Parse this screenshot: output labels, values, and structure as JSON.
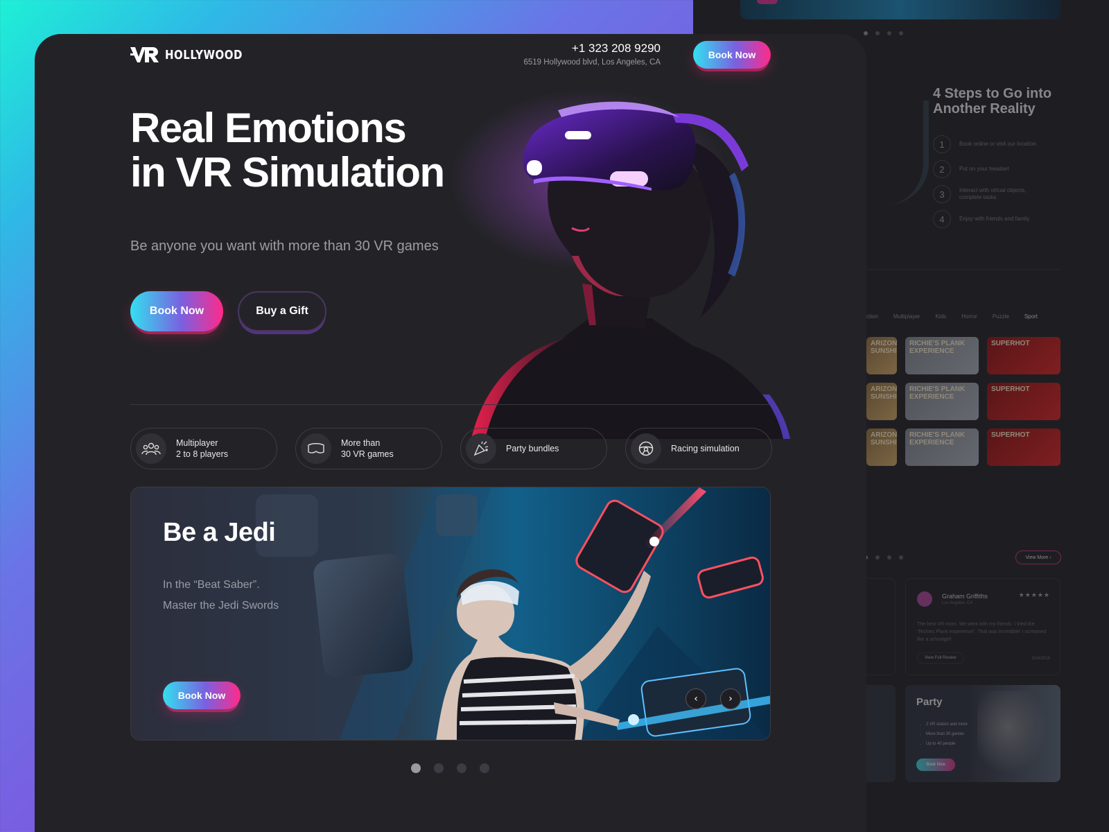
{
  "brand": {
    "name": "HOLLYWOOD"
  },
  "header": {
    "phone": "+1 323 208 9290",
    "address": "6519 Hollywood blvd, Los Angeles, CA",
    "book_label": "Book Now"
  },
  "hero": {
    "headline_line1": "Real Emotions",
    "headline_line2": "in VR Simulation",
    "subline": "Be anyone you want with more than 30 VR games",
    "book_label": "Book Now",
    "gift_label": "Buy a Gift"
  },
  "features": [
    {
      "icon": "group-icon",
      "label": "Multiplayer\n2 to 8 players"
    },
    {
      "icon": "vr-headset-icon",
      "label": "More than\n30 VR games"
    },
    {
      "icon": "party-popper-icon",
      "label": "Party bundles"
    },
    {
      "icon": "steering-wheel-icon",
      "label": "Racing simulation"
    }
  ],
  "banner": {
    "title": "Be a Jedi",
    "desc_line1": "In the “Beat Saber”.",
    "desc_line2": "Master the Jedi Swords",
    "book_label": "Book Now",
    "prev_icon": "chevron-left-icon",
    "next_icon": "chevron-right-icon"
  },
  "pager": {
    "count": 4,
    "active": 1
  },
  "side": {
    "steps_title_1": "4 Steps to Go into",
    "steps_title_2": "Another Reality",
    "steps": [
      {
        "n": "1",
        "text": "Book online or visit our location"
      },
      {
        "n": "2",
        "text": "Put on your headset"
      },
      {
        "n": "3",
        "text": "Interact with virtual objects, complete tasks"
      },
      {
        "n": "4",
        "text": "Enjoy with friends and family"
      }
    ],
    "categories": [
      "ction",
      "Multiplayer",
      "Kids",
      "Horror",
      "Puzzle",
      "Sport"
    ],
    "game_a": "ARIZONA SUNSHINE",
    "game_b": "RICHIE'S PLANK EXPERIENCE",
    "game_c": "SUPERHOT",
    "view_more": "View More",
    "review": {
      "name": "Graham Griffiths",
      "location": "Los Angeles, CA",
      "stars": "★★★★★",
      "text": "The best VR room. We went with my friends. I tried the \"Richies Plank experience\". That was incredible! I screamed like a schoolgirl!",
      "button": "View Full Review",
      "date": "3/14/2019"
    },
    "party": {
      "title": "Party",
      "items": [
        "2 VR station and more",
        "More than 30 games",
        "Up to 40 people"
      ],
      "button": "Book Now"
    }
  },
  "colors": {
    "accent_cyan": "#33e0f0",
    "accent_pink": "#ff2a8a",
    "card_bg": "#232327"
  }
}
